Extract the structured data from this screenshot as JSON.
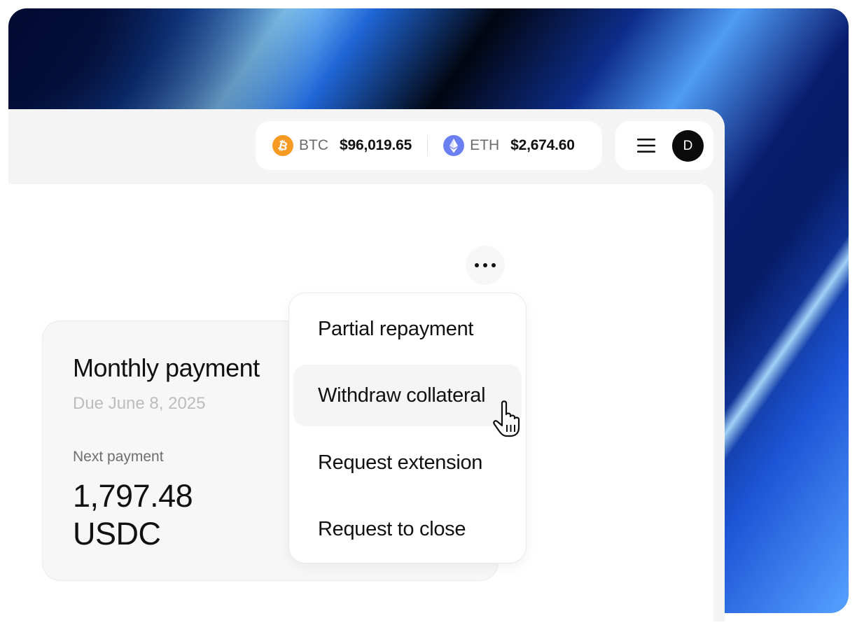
{
  "ticker": {
    "coins": [
      {
        "symbol": "BTC",
        "price": "$96,019.65",
        "icon": "bitcoin-icon",
        "color": "#f59a23"
      },
      {
        "symbol": "ETH",
        "price": "$2,674.60",
        "icon": "ethereum-icon",
        "color": "#6c7ff0"
      }
    ]
  },
  "header": {
    "menu_icon": "hamburger-menu-icon",
    "avatar_initial": "D"
  },
  "card": {
    "title": "Monthly payment",
    "due": "Due June 8, 2025",
    "next_label": "Next payment",
    "amount": "1,797.48",
    "currency": "USDC"
  },
  "more_menu": {
    "icon": "more-horizontal-icon",
    "items": [
      {
        "label": "Partial repayment"
      },
      {
        "label": "Withdraw collateral",
        "hovered": true
      },
      {
        "label": "Request extension"
      },
      {
        "label": "Request to close"
      }
    ]
  }
}
